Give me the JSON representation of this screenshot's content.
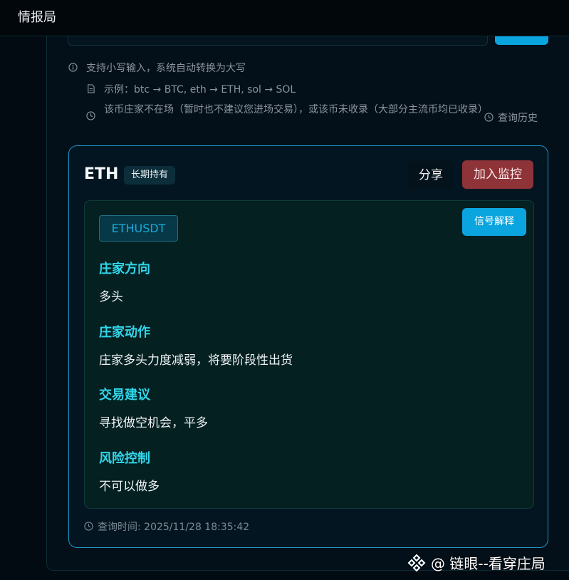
{
  "header": {
    "title": "情报局"
  },
  "tips": {
    "lowercase": "支持小写输入，系统自动转换为大写",
    "example": "示例：btc → BTC, eth → ETH, sol → SOL",
    "warning": "该币庄家不在场（暂时也不建议您进场交易），或该币未收录（大部分主流币均已收录）",
    "history": "查询历史"
  },
  "result": {
    "coin": "ETH",
    "badge": "长期持有",
    "share_label": "分享",
    "monitor_label": "加入监控",
    "pair": "ETHUSDT",
    "explain_label": "信号解释",
    "sections": [
      {
        "title": "庄家方向",
        "body": "多头"
      },
      {
        "title": "庄家动作",
        "body": "庄家多头力度减弱，将要阶段性出货"
      },
      {
        "title": "交易建议",
        "body": "寻找做空机会，平多"
      },
      {
        "title": "风险控制",
        "body": "不可以做多"
      }
    ],
    "query_time": "查询时间: 2025/11/28 18:35:42"
  },
  "watermark": {
    "text": "@ 链眼--看穿庄局"
  },
  "colors": {
    "accent": "#0aa5df",
    "danger": "#8e3338",
    "section_title": "#31d6ea",
    "card_border": "#1a97c8"
  }
}
